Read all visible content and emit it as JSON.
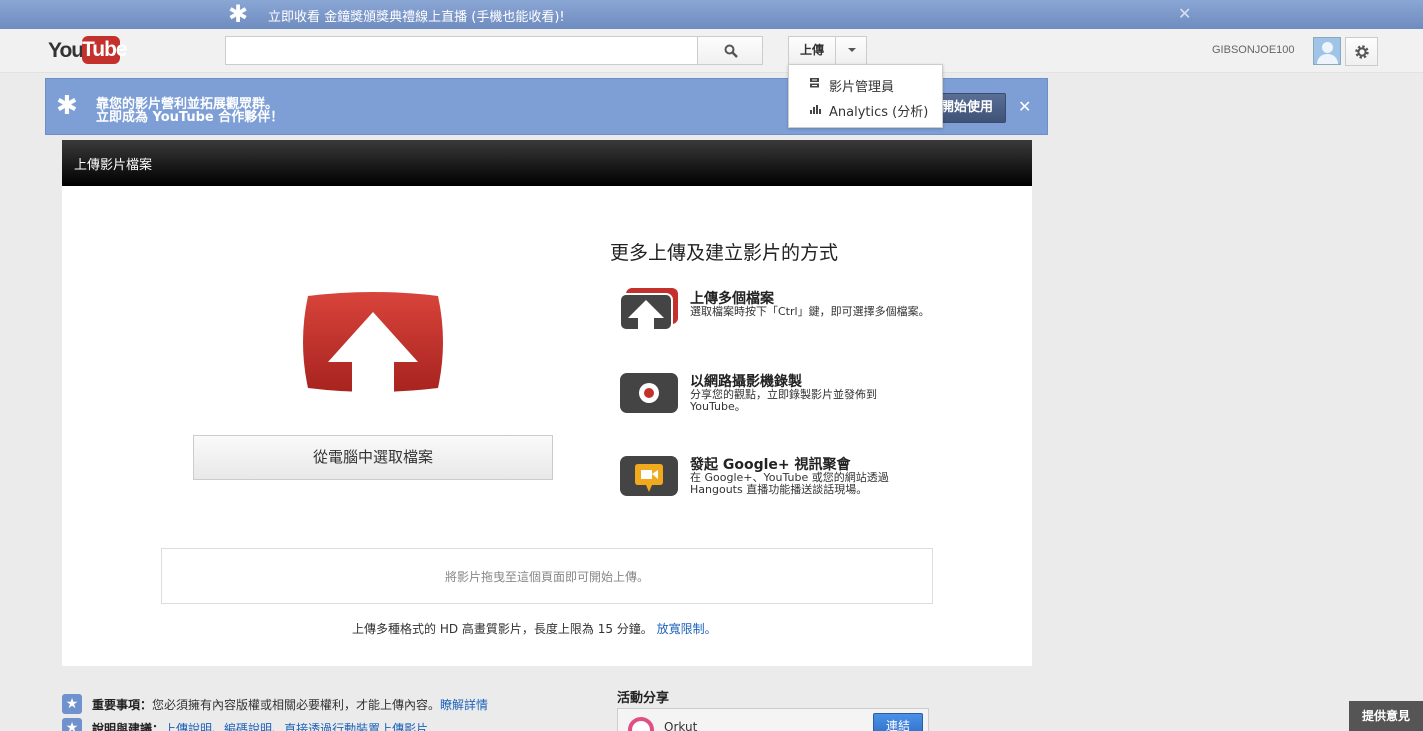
{
  "topbar": {
    "message": "立即收看 金鐘獎頒獎典禮線上直播 (手機也能收看)!"
  },
  "masthead": {
    "logo_you": "You",
    "logo_tube": "Tube",
    "search_value": "",
    "upload_label": "上傳",
    "username": "GIBSONJOE100"
  },
  "dropdown": {
    "items": [
      {
        "label": "影片管理員"
      },
      {
        "label": "Analytics (分析)"
      }
    ]
  },
  "partner": {
    "line1": "靠您的影片營利並拓展觀眾群。",
    "line2": "立即成為 YouTube 合作夥伴！",
    "start_label": "開始使用"
  },
  "upload": {
    "header_title": "上傳影片檔案",
    "select_label": "從電腦中選取檔案",
    "more_title": "更多上傳及建立影片的方式",
    "options": [
      {
        "title": "上傳多個檔案",
        "desc": "選取檔案時按下「Ctrl」鍵，即可選擇多個檔案。"
      },
      {
        "title": "以網路攝影機錄製",
        "desc": "分享您的觀點，立即錄製影片並發佈到 YouTube。"
      },
      {
        "title": "發起 Google+ 視訊聚會",
        "desc": "在 Google+、YouTube 或您的網站透過 Hangouts 直播功能播送談話現場。"
      }
    ],
    "dropzone_text": "將影片拖曳至這個頁面即可開始上傳。",
    "hd_text": "上傳多種格式的 HD 高畫質影片，長度上限為 15 分鐘。",
    "hd_link": "放寬限制。"
  },
  "notes": {
    "important_label": "重要事項：",
    "important_text": "您必須擁有內容版權或相關必要權利，才能上傳內容。",
    "important_link": "瞭解詳情",
    "help_label": "說明與建議：",
    "help_links": [
      "上傳說明",
      "編碼說明",
      "直接透過行動裝置上傳影片"
    ]
  },
  "activity": {
    "title": "活動分享",
    "service_name": "Orkut",
    "connect_label": "連結"
  },
  "feedback_label": "提供意見",
  "colors": {
    "topbar": "#7d9ac9",
    "partner_banner": "#7d9fd6",
    "upload_red": "#c4302b",
    "link": "#1c62b9"
  }
}
